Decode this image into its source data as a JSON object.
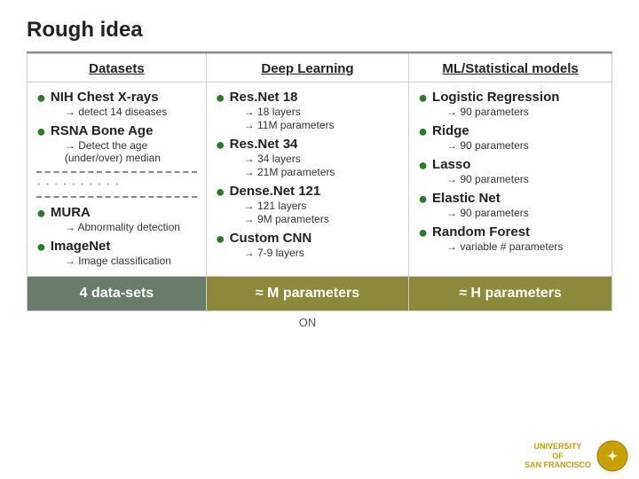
{
  "page": {
    "title": "Rough idea"
  },
  "columns": {
    "datasets": "Datasets",
    "dl": "Deep Learning",
    "ml": "ML/Statistical models"
  },
  "datasets_items": [
    {
      "title": "NIH Chest X-rays",
      "sub": [
        "→ detect 14 diseases"
      ]
    },
    {
      "title": "RSNA Bone Age",
      "sub": [
        "→ Detect the age (under/over) median"
      ]
    },
    {
      "title": "MURA",
      "sub": [
        "→ Abnormality detection"
      ]
    },
    {
      "title": "ImageNet",
      "sub": [
        "→ Image classification"
      ]
    }
  ],
  "dl_items": [
    {
      "title": "Res.Net 18",
      "sub": [
        "→ 18 layers",
        "→ 11M parameters"
      ]
    },
    {
      "title": "Res.Net 34",
      "sub": [
        "→ 34 layers",
        "→ 21M parameters"
      ]
    },
    {
      "title": "Dense.Net 121",
      "sub": [
        "→ 121 layers",
        "→ 9M parameters"
      ]
    },
    {
      "title": "Custom CNN",
      "sub": [
        "→ 7-9 layers"
      ]
    }
  ],
  "ml_items": [
    {
      "title": "Logistic Regression",
      "sub": [
        "→ 90 parameters"
      ]
    },
    {
      "title": "Ridge",
      "sub": [
        "→ 90 parameters"
      ]
    },
    {
      "title": "Lasso",
      "sub": [
        "→ 90 parameters"
      ]
    },
    {
      "title": "Elastic Net",
      "sub": [
        "→ 90 parameters"
      ]
    },
    {
      "title": "Random Forest",
      "sub": [
        "→ variable # parameters"
      ]
    }
  ],
  "summary": {
    "datasets": "4 data-sets",
    "dl": "≈ M parameters",
    "ml": "≈ H parameters"
  },
  "footer": {
    "on_label": "ON"
  }
}
